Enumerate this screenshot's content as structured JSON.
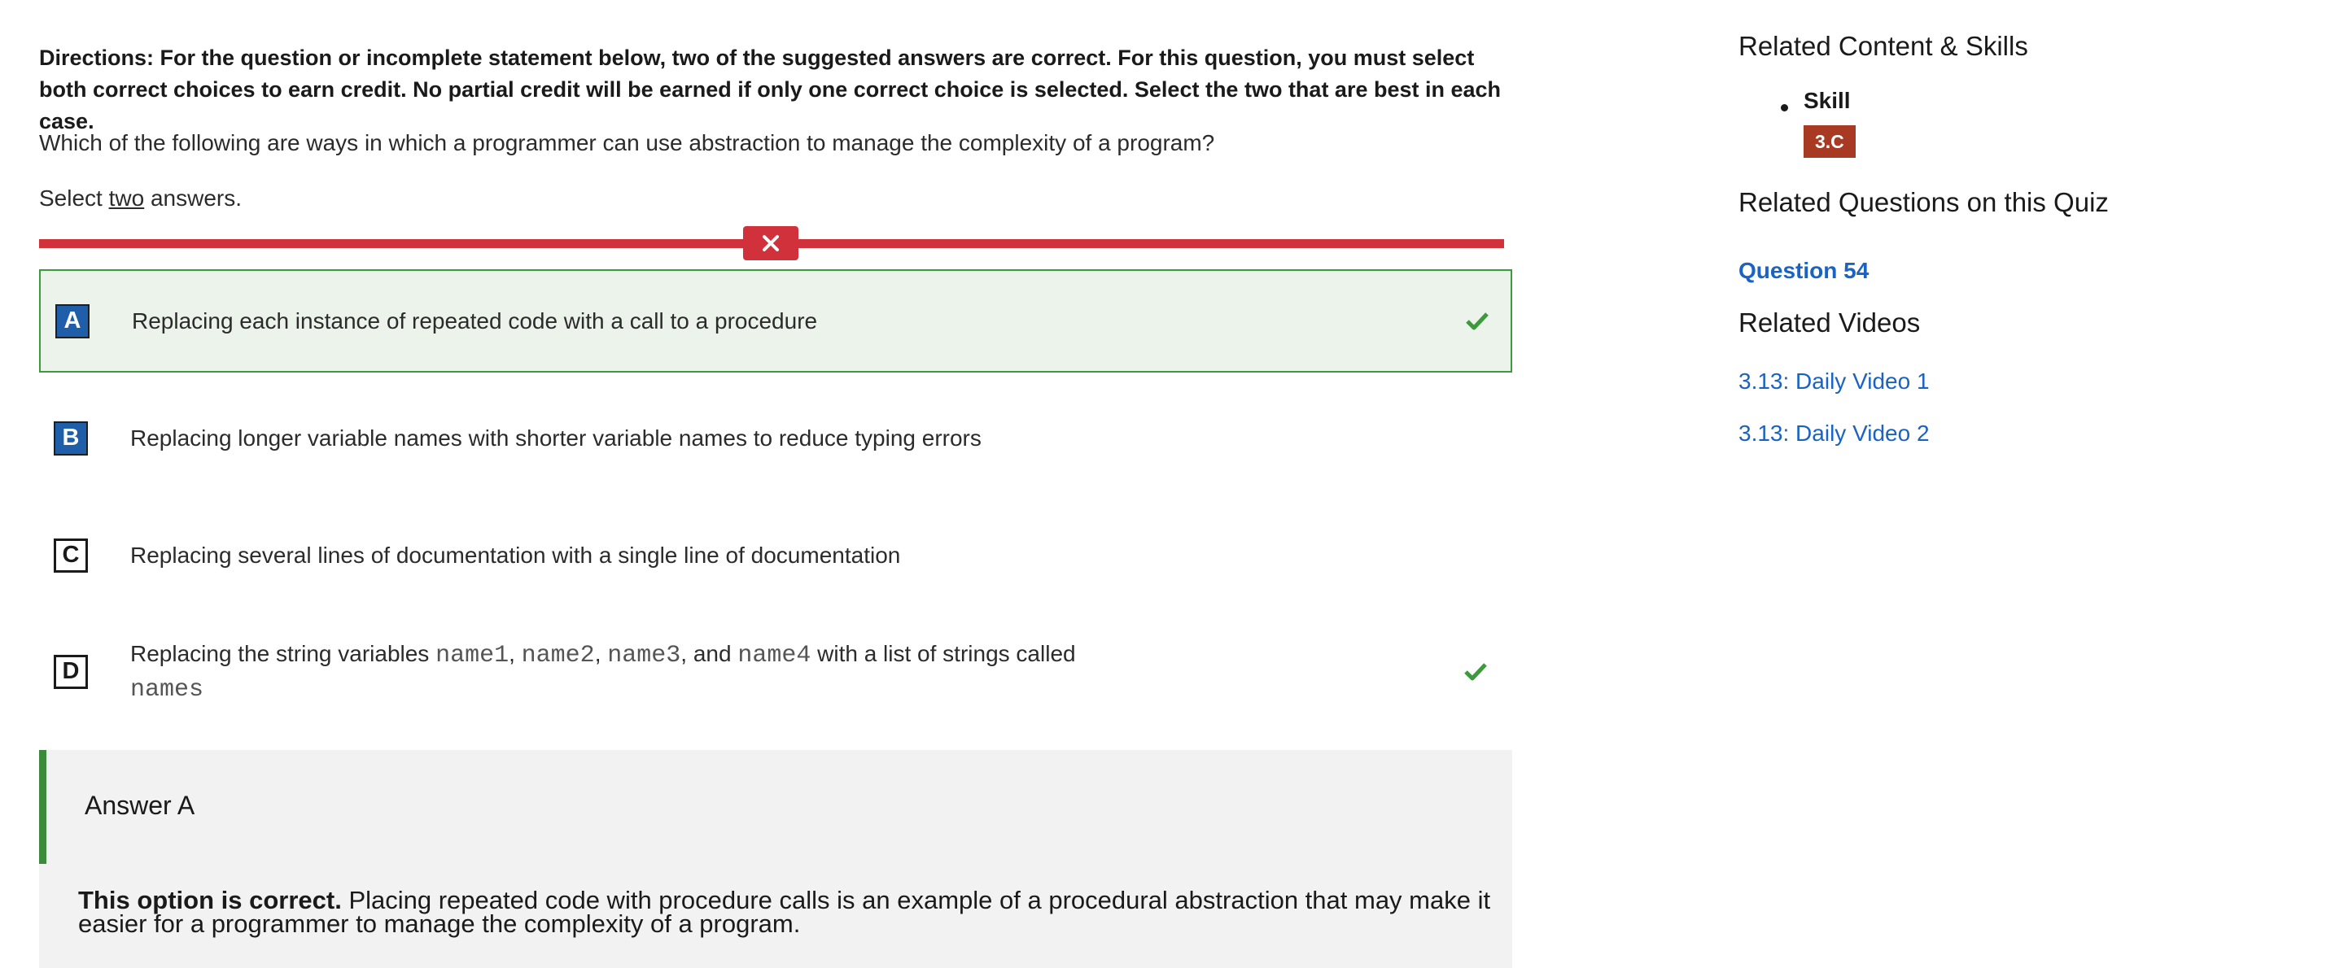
{
  "question": {
    "directions": "Directions: For the question or incomplete statement below, two of the suggested answers are correct. For this question, you must select both correct choices to earn credit. No partial credit will be earned if only one correct choice is selected. Select the two that are best in each case.",
    "prompt": "Which of the following are ways in which a programmer can use abstraction to manage the complexity of a program?",
    "select_prefix": "Select",
    "select_count": "two",
    "select_suffix": "answers."
  },
  "result": {
    "status": "incorrect",
    "icon": "close-icon",
    "color": "#d0313a"
  },
  "choices": [
    {
      "letter": "A",
      "text": "Replacing each instance of repeated code with a call to a procedure",
      "selected": true,
      "correct": true
    },
    {
      "letter": "B",
      "text": "Replacing longer variable names with shorter variable names to reduce typing errors",
      "selected": true,
      "correct": false
    },
    {
      "letter": "C",
      "text": "Replacing several lines of documentation with a single line of documentation",
      "selected": false,
      "correct": false
    },
    {
      "letter": "D",
      "text_parts": [
        "Replacing the string variables ",
        "name1",
        ", ",
        "name2",
        ", ",
        "name3",
        ", and ",
        "name4",
        " with a list of strings called ",
        "names"
      ],
      "selected": false,
      "correct": true
    }
  ],
  "answer_panel": {
    "title": "Answer A",
    "explanation_bold": "This option is correct.",
    "explanation_text": " Placing repeated code with procedure calls is an example of a procedural abstraction that may make it easier for a programmer to manage the complexity of a program."
  },
  "sidebar": {
    "related_content_heading": "Related Content & Skills",
    "skill_label": "Skill",
    "skill_badge": "3.C",
    "related_questions_heading": "Related Questions on this Quiz",
    "related_questions": [
      "Question 54"
    ],
    "related_videos_heading": "Related Videos",
    "related_videos": [
      "3.13: Daily Video 1",
      "3.13: Daily Video 2"
    ]
  },
  "colors": {
    "correct_green": "#3c9a3c",
    "selected_bg": "#ebf3eb",
    "letter_blue": "#1f5ea8",
    "link_blue": "#1a63c2",
    "badge_red": "#a83a24"
  }
}
